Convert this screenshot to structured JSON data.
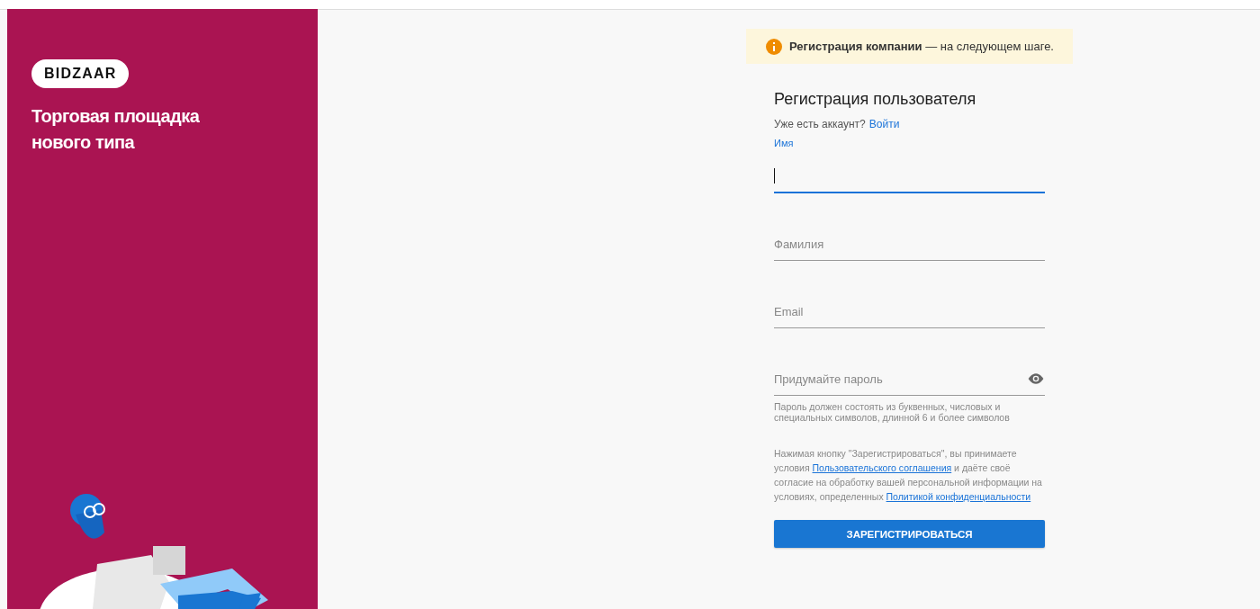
{
  "brand": {
    "logo": "BIDZAAR",
    "tagline": "Торговая площадка нового типа"
  },
  "notice": {
    "text": "**Регистрация компании** — на следующем шаге."
  },
  "form": {
    "title": "Регистрация пользователя",
    "login_prompt": "Уже есть аккаунт?",
    "login_link": "Войти",
    "fields": [
      {
        "kind": "text",
        "label": "Имя",
        "focused": true
      },
      {
        "kind": "text",
        "placeholder": "Фамилия",
        "focused": false
      },
      {
        "kind": "text",
        "placeholder": "Email",
        "focused": false
      },
      {
        "kind": "password",
        "placeholder": "Придумайте пароль",
        "focused": false,
        "hint": "Пароль должен состоять из буквенных, числовых и специальных символов, длинной 6 и более символов"
      }
    ],
    "consent": [
      {
        "kind": "text",
        "text": "Нажимая кнопку \"Зарегистрироваться\", вы принимаете условия "
      },
      {
        "kind": "link",
        "text": "Пользовательского соглашения"
      },
      {
        "kind": "text",
        "text": " и даёте своё согласие на обработку вашей персональной информации на условиях, определенных "
      },
      {
        "kind": "link",
        "text": "Политикой конфиденциальности"
      }
    ],
    "submit": "ЗАРЕГИСТРИРОВАТЬСЯ"
  }
}
